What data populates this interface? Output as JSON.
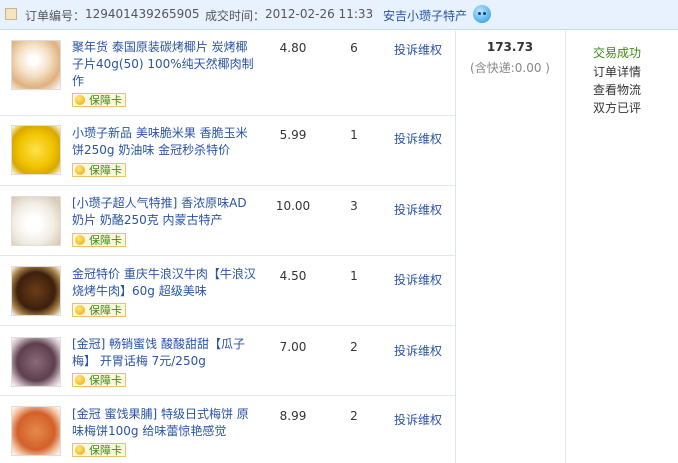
{
  "order": {
    "number_label": "订单编号：",
    "number": "129401439265905",
    "time_label": "成交时间：",
    "time": "2012-02-26 11:33",
    "shop": "安吉小瓒子特产"
  },
  "items": [
    {
      "title": "聚年货 泰国原装碳烤椰片 炭烤椰子片40g(50) 100%纯天然椰肉制作",
      "guarantee": "保障卡",
      "price": "4.80",
      "qty": "6",
      "complain": "投诉维权"
    },
    {
      "title": "小瓒子新品 美味脆米果 香脆玉米饼250g 奶油味 金冠秒杀特价",
      "guarantee": "保障卡",
      "price": "5.99",
      "qty": "1",
      "complain": "投诉维权"
    },
    {
      "title": "[小瓒子超人气特推] 香浓原味AD奶片 奶酪250克 内蒙古特产",
      "guarantee": "保障卡",
      "price": "10.00",
      "qty": "3",
      "complain": "投诉维权"
    },
    {
      "title": "金冠特价 重庆牛浪汉牛肉【牛浪汉烧烤牛肉】60g 超级美味",
      "guarantee": "保障卡",
      "price": "4.50",
      "qty": "1",
      "complain": "投诉维权"
    },
    {
      "title": "[金冠] 畅销蜜饯 酸酸甜甜【瓜子梅】 开胃话梅 7元/250g",
      "guarantee": "保障卡",
      "price": "7.00",
      "qty": "2",
      "complain": "投诉维权"
    },
    {
      "title": "[金冠 蜜饯果脯] 特级日式梅饼 原味梅饼100g 给味蕾惊艳感觉",
      "guarantee": "保障卡",
      "price": "8.99",
      "qty": "2",
      "complain": "投诉维权"
    }
  ],
  "summary": {
    "total": "173.73",
    "shipping_note": "(含快递:0.00 )"
  },
  "status": {
    "state": "交易成功",
    "links": [
      "订单详情",
      "查看物流",
      "双方已评"
    ]
  }
}
